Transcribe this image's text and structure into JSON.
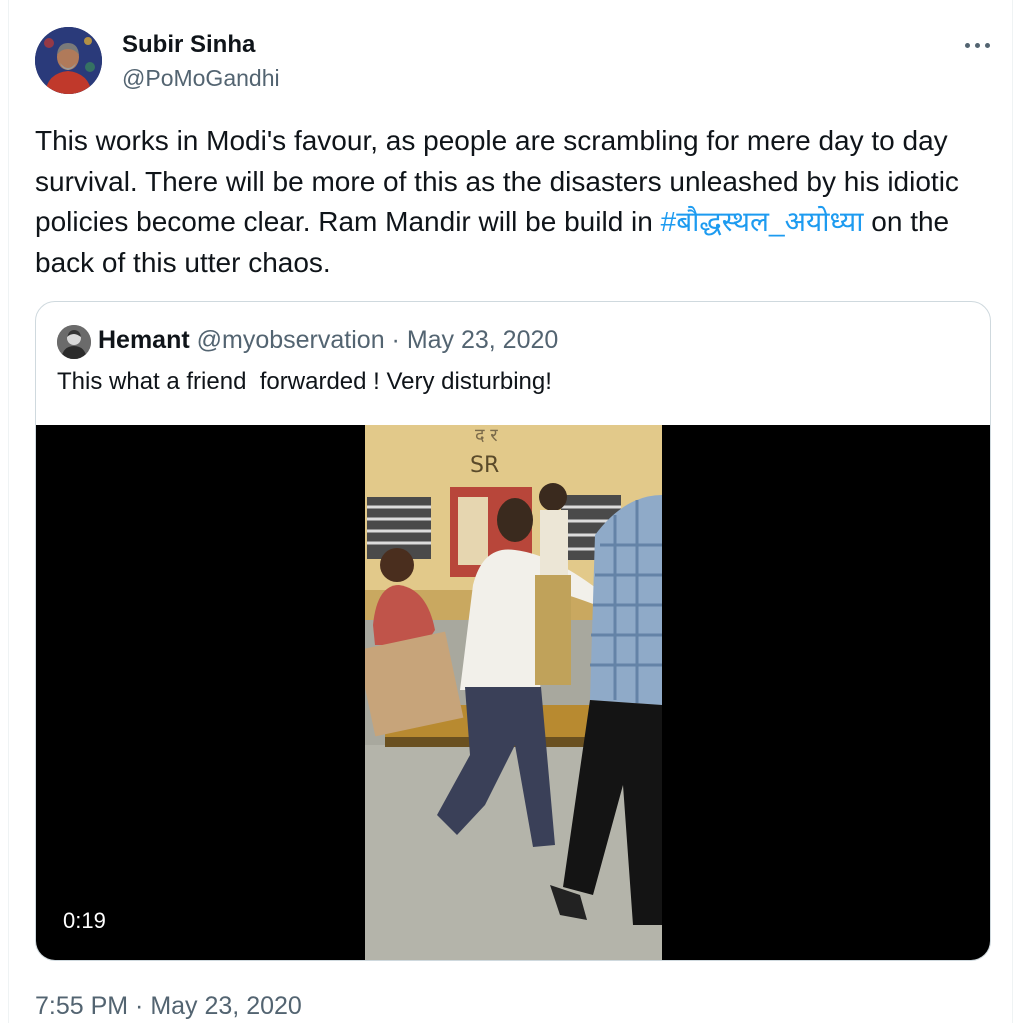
{
  "tweet": {
    "author": {
      "display_name": "Subir Sinha",
      "handle": "@PoMoGandhi"
    },
    "more_icon": "more-horizontal-icon",
    "text_before_hashtag": "This works in Modi's favour, as people are scrambling for mere day to day survival. There will be more of this as the disasters unleashed by his idiotic policies become clear. Ram Mandir will be build in ",
    "hashtag": "#बौद्धस्थल_अयोध्या",
    "text_after_hashtag": " on the back of this utter chaos.",
    "timestamp": "7:55 PM · May 23, 2020"
  },
  "quoted_tweet": {
    "author_name": "Hemant",
    "author_handle": "@myobservation",
    "separator": " · ",
    "date": "May 23, 2020",
    "text": "This what a friend  forwarded ! Very disturbing!",
    "video": {
      "duration": "0:19",
      "sign_text_top": "द र",
      "sign_text": "SR"
    }
  },
  "colors": {
    "text": "#0f1419",
    "secondary": "#536471",
    "link": "#1d9bf0",
    "border": "#cfd9de"
  }
}
